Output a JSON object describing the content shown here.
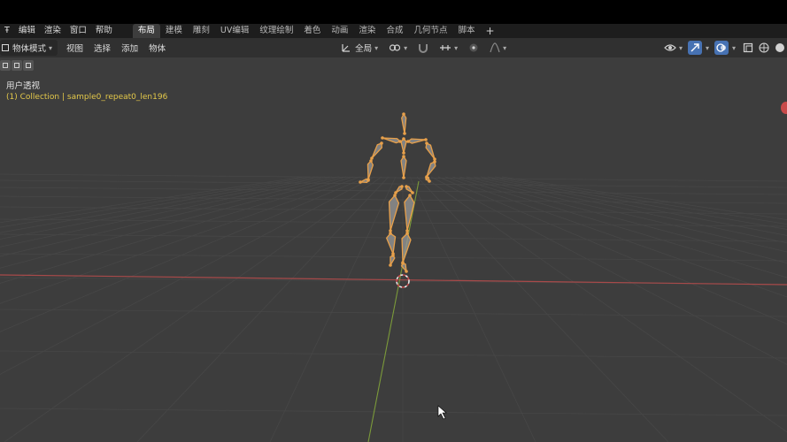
{
  "menubar": {
    "items": [
      "Ŧ",
      "编辑",
      "渲染",
      "窗口",
      "帮助"
    ],
    "workspace_tabs": [
      {
        "label": "布局",
        "active": true
      },
      {
        "label": "建模",
        "active": false
      },
      {
        "label": "雕刻",
        "active": false
      },
      {
        "label": "UV编辑",
        "active": false
      },
      {
        "label": "纹理绘制",
        "active": false
      },
      {
        "label": "着色",
        "active": false
      },
      {
        "label": "动画",
        "active": false
      },
      {
        "label": "渲染",
        "active": false
      },
      {
        "label": "合成",
        "active": false
      },
      {
        "label": "几何节点",
        "active": false
      },
      {
        "label": "脚本",
        "active": false
      }
    ],
    "add_tab": "+"
  },
  "header": {
    "mode_label": "物体模式",
    "menus": [
      "视图",
      "选择",
      "添加",
      "物体"
    ],
    "transform_orientation": "全局"
  },
  "viewport": {
    "view_name": "用户透视",
    "collection_info": "(1) Collection | sample0_repeat0_len196"
  },
  "colors": {
    "bone": "#e8a04a",
    "bone_fill": "#9a9a9a",
    "x_axis": "#a84a4a",
    "y_axis": "#7b9a3a",
    "grid": "#474747",
    "accent": "#4772b3"
  }
}
